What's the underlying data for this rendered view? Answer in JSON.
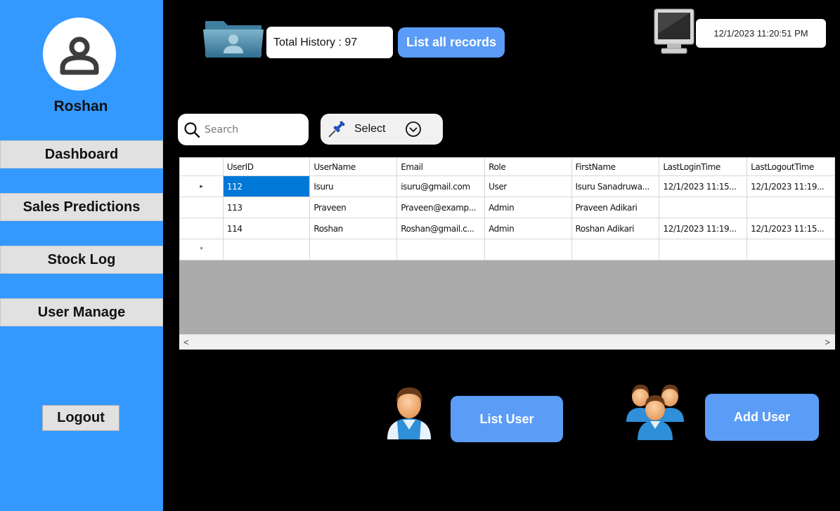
{
  "sidebar": {
    "user_name": "Roshan",
    "nav": [
      "Dashboard",
      "Sales Predictions",
      "Stock Log",
      "User Manage"
    ],
    "logout_label": "Logout"
  },
  "header": {
    "history_label": "Total History : 97",
    "list_all_label": "List all records",
    "datetime": "12/1/2023 11:20:51 PM"
  },
  "search": {
    "placeholder": "Search",
    "value": ""
  },
  "filter": {
    "label": "Select"
  },
  "grid": {
    "columns": [
      "UserID",
      "UserName",
      "Email",
      "Role",
      "FirstName",
      "LastLoginTime",
      "LastLogoutTime"
    ],
    "rows": [
      [
        "112",
        "Isuru",
        "isuru@gmail.com",
        "User",
        "Isuru Sanadruwa...",
        "12/1/2023 11:15...",
        "12/1/2023 11:19..."
      ],
      [
        "113",
        "Praveen",
        "Praveen@examp...",
        "Admin",
        "Praveen  Adikari",
        "",
        ""
      ],
      [
        "114",
        "Roshan",
        "Roshan@gmail.c...",
        "Admin",
        "Roshan Adikari",
        "12/1/2023 11:19...",
        "12/1/2023 11:15..."
      ]
    ],
    "current_row_marker": "▸",
    "new_row_marker": "*",
    "scroll_left": "<",
    "scroll_right": ">"
  },
  "actions": {
    "list_user_label": "List User",
    "add_user_label": "Add User"
  },
  "colors": {
    "sidebar": "#3399ff",
    "accent_button": "#5b9cf7",
    "selection": "#0078d7"
  },
  "icons": [
    "user-avatar-icon",
    "folder-user-icon",
    "monitor-icon",
    "search-icon",
    "pin-icon",
    "chevron-down-circle-icon",
    "single-user-icon",
    "user-group-icon"
  ]
}
